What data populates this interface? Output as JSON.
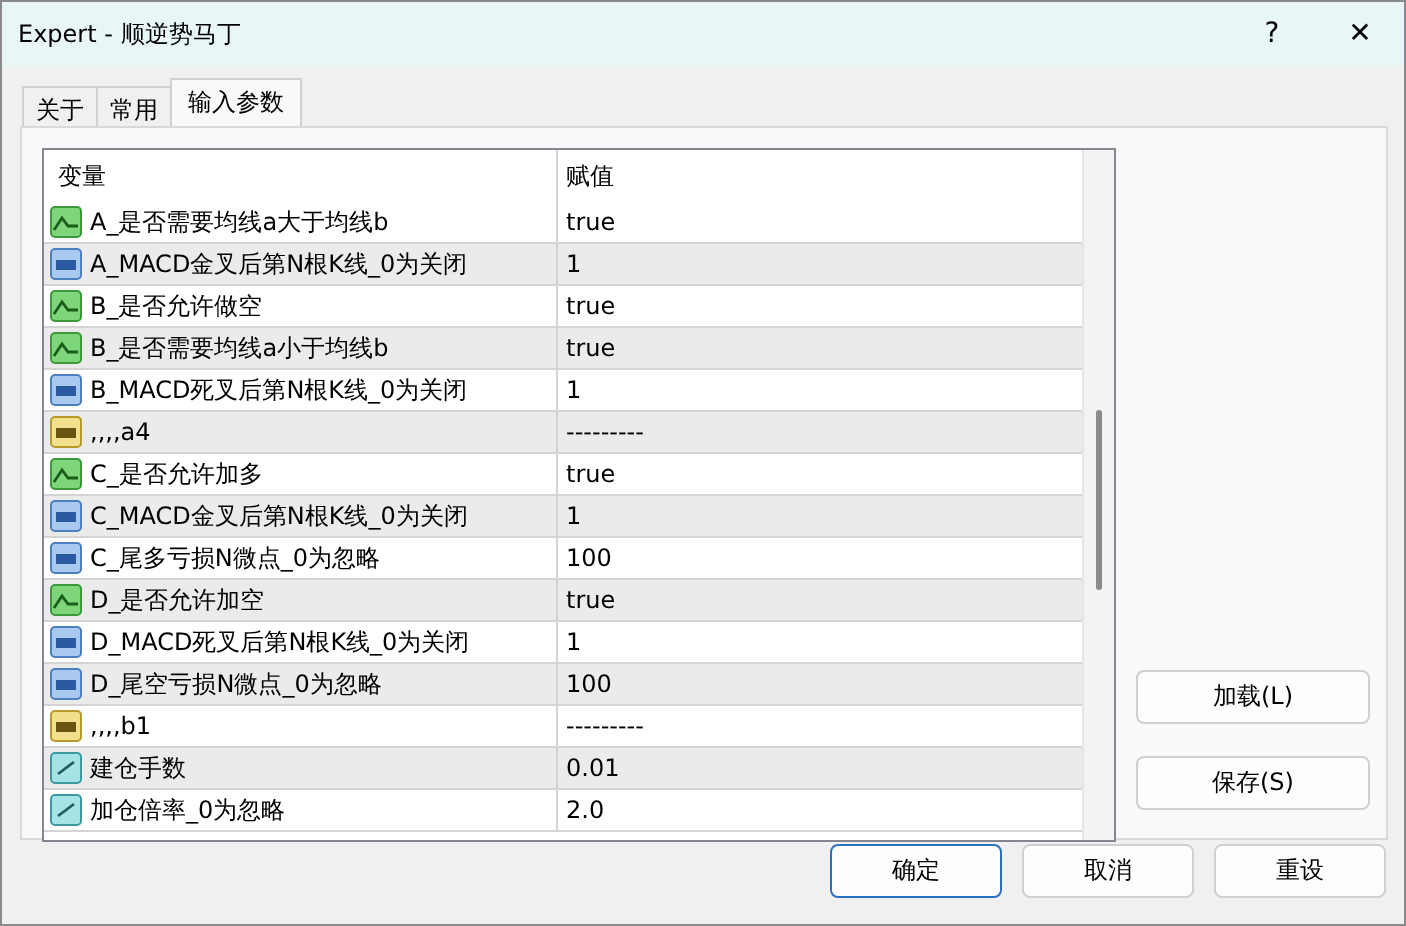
{
  "window": {
    "title": "Expert - 顺逆势马丁",
    "help": "?",
    "close": "✕"
  },
  "tabs": [
    {
      "label": "关于",
      "selected": false
    },
    {
      "label": "常用",
      "selected": false
    },
    {
      "label": "输入参数",
      "selected": true
    }
  ],
  "table": {
    "columns": [
      "变量",
      "赋值"
    ],
    "rows": [
      {
        "kind": "bool",
        "name": "A_是否需要均线a大于均线b",
        "value": "true"
      },
      {
        "kind": "int",
        "name": "A_MACD金叉后第N根K线_0为关闭",
        "value": "1"
      },
      {
        "kind": "bool",
        "name": "B_是否允许做空",
        "value": "true"
      },
      {
        "kind": "bool",
        "name": "B_是否需要均线a小于均线b",
        "value": "true"
      },
      {
        "kind": "int",
        "name": "B_MACD死叉后第N根K线_0为关闭",
        "value": "1"
      },
      {
        "kind": "string",
        "name": ",,,,a4",
        "value": "---------"
      },
      {
        "kind": "bool",
        "name": "C_是否允许加多",
        "value": "true"
      },
      {
        "kind": "int",
        "name": "C_MACD金叉后第N根K线_0为关闭",
        "value": "1"
      },
      {
        "kind": "int",
        "name": "C_尾多亏损N微点_0为忽略",
        "value": "100"
      },
      {
        "kind": "bool",
        "name": "D_是否允许加空",
        "value": "true"
      },
      {
        "kind": "int",
        "name": "D_MACD死叉后第N根K线_0为关闭",
        "value": "1"
      },
      {
        "kind": "int",
        "name": "D_尾空亏损N微点_0为忽略",
        "value": "100"
      },
      {
        "kind": "string",
        "name": ",,,,b1",
        "value": "---------"
      },
      {
        "kind": "double",
        "name": "建仓手数",
        "value": "0.01"
      },
      {
        "kind": "double",
        "name": "加仓倍率_0为忽略",
        "value": "2.0"
      }
    ]
  },
  "side_buttons": [
    "加载(L)",
    "保存(S)"
  ],
  "buttons": [
    {
      "label": "确定",
      "default": true
    },
    {
      "label": "取消",
      "default": false
    },
    {
      "label": "重设",
      "default": false
    }
  ]
}
